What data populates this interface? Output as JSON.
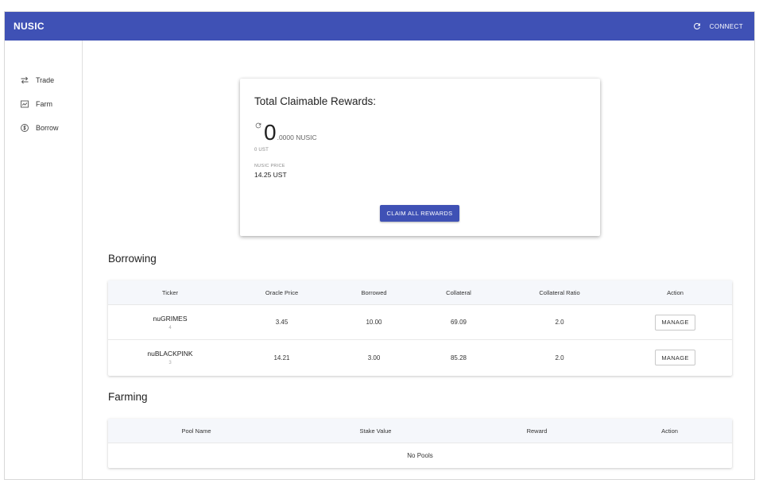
{
  "header": {
    "title": "NUSIC",
    "connect_label": "CONNECT",
    "refresh_icon": "refresh-icon"
  },
  "sidebar": {
    "items": [
      {
        "label": "Trade",
        "icon": "swap-arrows-icon"
      },
      {
        "label": "Farm",
        "icon": "chart-icon"
      },
      {
        "label": "Borrow",
        "icon": "borrow-icon"
      }
    ]
  },
  "rewards": {
    "title": "Total Claimable Rewards:",
    "amount_int": "0",
    "amount_dec": ".0000 NUSIC",
    "ust_value": "0 UST",
    "price_label": "NUSIC PRICE",
    "price_value": "14.25 UST",
    "claim_label": "CLAIM ALL REWARDS"
  },
  "borrowing": {
    "title": "Borrowing",
    "headers": [
      "Ticker",
      "Oracle Price",
      "Borrowed",
      "Collateral",
      "Collateral Ratio",
      "Action"
    ],
    "rows": [
      {
        "ticker": "nuGRIMES",
        "id": "4",
        "oracle": "3.45",
        "borrowed": "10.00",
        "collateral": "69.09",
        "ratio": "2.0",
        "action": "MANAGE"
      },
      {
        "ticker": "nuBLACKPINK",
        "id": "3",
        "oracle": "14.21",
        "borrowed": "3.00",
        "collateral": "85.28",
        "ratio": "2.0",
        "action": "MANAGE"
      }
    ]
  },
  "farming": {
    "title": "Farming",
    "headers": [
      "Pool Name",
      "Stake Value",
      "Reward",
      "Action"
    ],
    "empty_text": "No Pools"
  },
  "colors": {
    "primary": "#3f51b5",
    "header_bg": "#f5f7fb"
  }
}
